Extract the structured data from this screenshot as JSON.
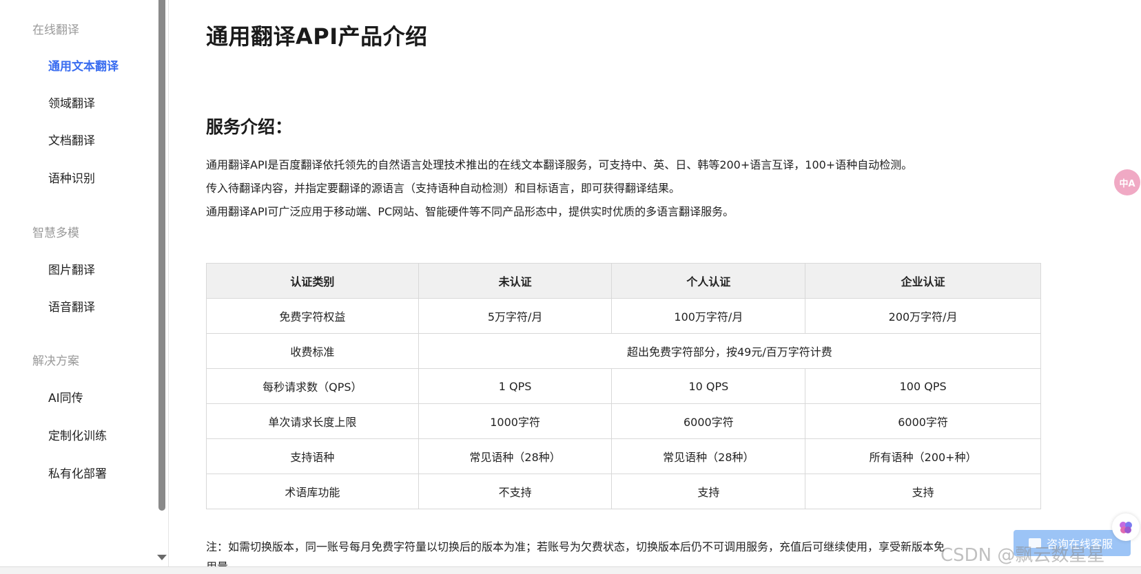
{
  "sidebar": {
    "groups": [
      {
        "title": "在线翻译",
        "items": [
          "通用文本翻译",
          "领域翻译",
          "文档翻译",
          "语种识别"
        ]
      },
      {
        "title": "智慧多模",
        "items": [
          "图片翻译",
          "语音翻译"
        ]
      },
      {
        "title": "解决方案",
        "items": [
          "AI同传",
          "定制化训练",
          "私有化部署"
        ]
      }
    ],
    "active_item": "通用文本翻译"
  },
  "main": {
    "title": "通用翻译API产品介绍",
    "section_title": "服务介绍：",
    "paragraphs": [
      "通用翻译API是百度翻译依托领先的自然语言处理技术推出的在线文本翻译服务，可支持中、英、日、韩等200+语言互译，100+语种自动检测。",
      "传入待翻译内容，并指定要翻译的源语言（支持语种自动检测）和目标语言，即可获得翻译结果。",
      "通用翻译API可广泛应用于移动端、PC网站、智能硬件等不同产品形态中，提供实时优质的多语言翻译服务。"
    ],
    "table": {
      "headers": [
        "认证类别",
        "未认证",
        "个人认证",
        "企业认证"
      ],
      "rows": [
        [
          "免费字符权益",
          "5万字符/月",
          "100万字符/月",
          "200万字符/月"
        ],
        [
          "收费标准",
          "超出免费字符部分，按49元/百万字符计费"
        ],
        [
          "每秒请求数（QPS）",
          "1 QPS",
          "10 QPS",
          "100 QPS"
        ],
        [
          "单次请求长度上限",
          "1000字符",
          "6000字符",
          "6000字符"
        ],
        [
          "支持语种",
          "常见语种（28种）",
          "常见语种（28种）",
          "所有语种（200+种）"
        ],
        [
          "术语库功能",
          "不支持",
          "支持",
          "支持"
        ]
      ]
    },
    "note": "注：如需切换版本，同一账号每月免费字符量以切换后的版本为准；若账号为欠费状态，切换版本后仍不可调用服务，充值后可继续使用，享受新版本免",
    "note_cont": "用量。"
  },
  "widgets": {
    "translate_badge": "中A",
    "chat_label": "咨询在线客服",
    "brain_icon": "brain-icon"
  },
  "watermark": "CSDN @飘云数星星"
}
